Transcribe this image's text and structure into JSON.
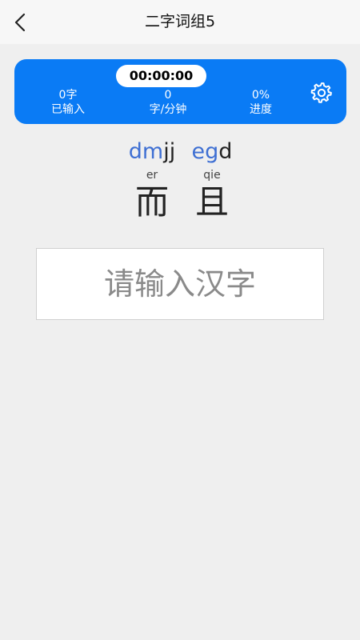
{
  "header": {
    "title": "二字词组5"
  },
  "stats": {
    "timer": "00:00:00",
    "typed_value": "0字",
    "typed_label": "已输入",
    "speed_value": "0",
    "speed_label": "字/分钟",
    "progress_value": "0%",
    "progress_label": "进度"
  },
  "words": [
    {
      "code_typed": "dm",
      "code_rest": "jj",
      "pinyin": "er",
      "hanzi": "而"
    },
    {
      "code_typed": "eg",
      "code_rest": "d",
      "pinyin": "qie",
      "hanzi": "且"
    }
  ],
  "input": {
    "placeholder": "请输入汉字",
    "value": ""
  },
  "icons": {
    "back": "chevron-left-icon",
    "settings": "gear-icon"
  },
  "colors": {
    "accent": "#0a7bf5",
    "code_typed": "#3e6fd3",
    "background": "#efefef"
  }
}
